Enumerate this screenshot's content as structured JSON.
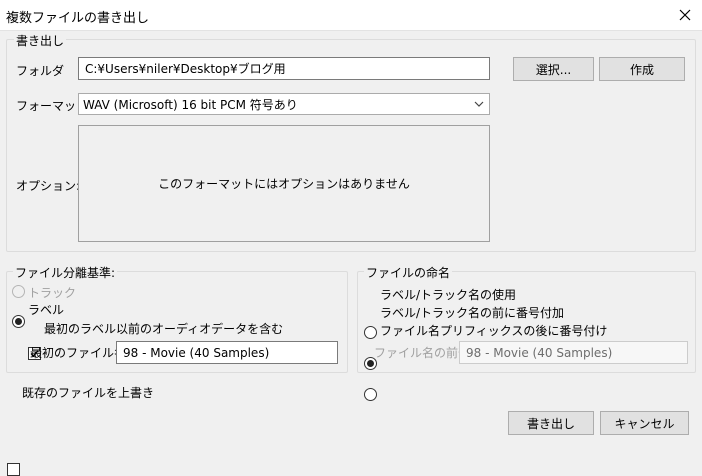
{
  "window": {
    "title": "複数ファイルの書き出し",
    "close_icon": "close-icon"
  },
  "export": {
    "legend": "書き出し",
    "folder_label": "フォルダ",
    "folder_value": "C:¥Users¥niler¥Desktop¥ブログ用",
    "select_button": "選択...",
    "create_button": "作成",
    "format_label": "フォーマット",
    "format_value": "WAV (Microsoft) 16 bit PCM 符号あり",
    "options_label": "オプション:",
    "options_message": "このフォーマットにはオプションはありません"
  },
  "split": {
    "legend": "ファイル分離基準:",
    "track": "トラック",
    "label": "ラベル",
    "include_audio": "最初のラベル以前のオーディオデータを含む",
    "first_file_label": "最初のファイル名",
    "first_file_value": "98 - Movie (40 Samples)"
  },
  "naming": {
    "legend": "ファイルの命名",
    "use_label": "ラベル/トラック名の使用",
    "number_before": "ラベル/トラック名の前に番号付加",
    "number_after": "ファイル名プリフィックスの後に番号付け",
    "prefix_label": "ファイル名の前部",
    "prefix_value": "98 - Movie (40 Samples)"
  },
  "overwrite": {
    "label": "既存のファイルを上書き"
  },
  "footer": {
    "export_button": "書き出し",
    "cancel_button": "キャンセル"
  }
}
